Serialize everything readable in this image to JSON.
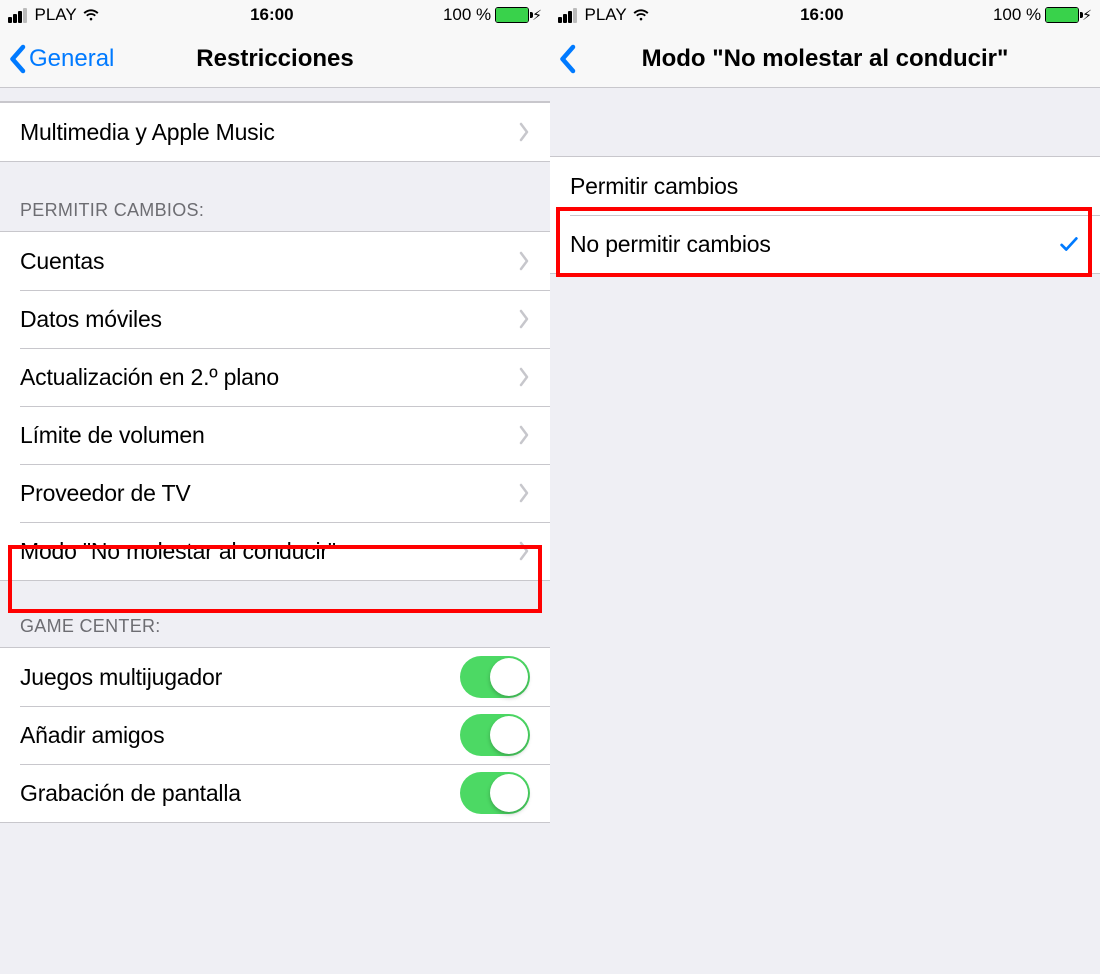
{
  "status": {
    "carrier": "PLAY",
    "time": "16:00",
    "battery_text": "100 %"
  },
  "left": {
    "back_label": "General",
    "title": "Restricciones",
    "top_row": "Multimedia y Apple Music",
    "section_allow_header": "PERMITIR CAMBIOS:",
    "allow_items": [
      "Cuentas",
      "Datos móviles",
      "Actualización en 2.º plano",
      "Límite de volumen",
      "Proveedor de TV",
      "Modo \"No molestar al conducir\""
    ],
    "section_gc_header": "GAME CENTER:",
    "gc_items": [
      {
        "label": "Juegos multijugador",
        "on": true
      },
      {
        "label": "Añadir amigos",
        "on": true
      },
      {
        "label": "Grabación de pantalla",
        "on": true
      }
    ]
  },
  "right": {
    "title": "Modo \"No molestar al conducir\"",
    "option_allow": "Permitir cambios",
    "option_disallow": "No permitir cambios",
    "selected": "disallow"
  }
}
